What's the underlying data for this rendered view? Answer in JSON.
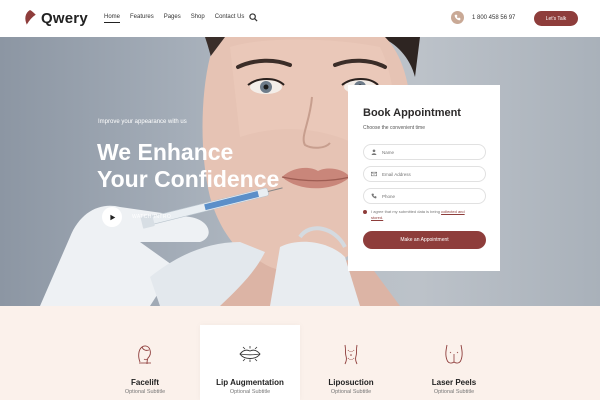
{
  "brand": {
    "name": "Qwery"
  },
  "nav": {
    "items": [
      "Home",
      "Features",
      "Pages",
      "Shop",
      "Contact Us"
    ]
  },
  "header": {
    "phone": "1 800 458 56 97",
    "cta": "Let's Talk"
  },
  "hero": {
    "tagline": "Improve your appearance with us",
    "title_line1": "We Enhance",
    "title_line2": "Your Confidence",
    "watch_label": "WATCH INTRO"
  },
  "appointment": {
    "title": "Book Appointment",
    "subtitle": "Choose the convenient time",
    "name_placeholder": "Name",
    "email_placeholder": "Email Address",
    "phone_placeholder": "Phone",
    "agree_text": "I agree that my submitted data is being",
    "agree_link": "collected and stored.",
    "submit": "Make an Appointment"
  },
  "services": [
    {
      "title": "Facelift",
      "subtitle": "Optional Subtitle",
      "icon": "face-icon"
    },
    {
      "title": "Lip Augmentation",
      "subtitle": "Optional Subtitle",
      "icon": "lips-icon"
    },
    {
      "title": "Liposuction",
      "subtitle": "Optional Subtitle",
      "icon": "body-icon"
    },
    {
      "title": "Laser Peels",
      "subtitle": "Optional Subtitle",
      "icon": "hips-icon"
    }
  ],
  "colors": {
    "accent": "#8e3d3b",
    "services_bg": "#fbf1eb",
    "phone_icon_bg": "#c9a996"
  }
}
